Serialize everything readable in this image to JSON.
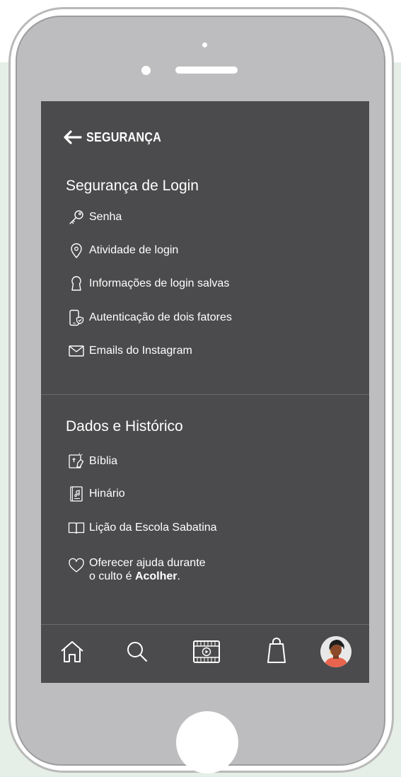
{
  "header": {
    "title": "SEGURANÇA"
  },
  "section_login": {
    "title": "Segurança de Login",
    "items": [
      {
        "label": "Senha",
        "icon": "key-icon"
      },
      {
        "label": "Atividade de login",
        "icon": "location-pin-icon"
      },
      {
        "label": "Informações de login salvas",
        "icon": "keyhole-icon"
      },
      {
        "label": "Autenticação de dois fatores",
        "icon": "phone-shield-icon"
      },
      {
        "label": "Emails do Instagram",
        "icon": "envelope-icon"
      }
    ]
  },
  "section_data": {
    "title": "Dados e Histórico",
    "items": [
      {
        "label": "Bíblia",
        "icon": "bible-icon"
      },
      {
        "label": "Hinário",
        "icon": "hymnal-icon"
      },
      {
        "label": "Lição da Escola Sabatina",
        "icon": "open-book-icon"
      },
      {
        "label_line1": "Oferecer ajuda durante",
        "label_line2_prefix": "o culto é ",
        "label_line2_bold": "Acolher",
        "label_line2_suffix": ".",
        "icon": "heart-icon"
      }
    ]
  },
  "bottom_nav": [
    "home-icon",
    "search-icon",
    "video-icon",
    "shopping-bag-icon",
    "avatar"
  ],
  "colors": {
    "screen": "#4b4b4d",
    "phone": "#bdbdbf",
    "background_panel": "#e6efe7"
  }
}
